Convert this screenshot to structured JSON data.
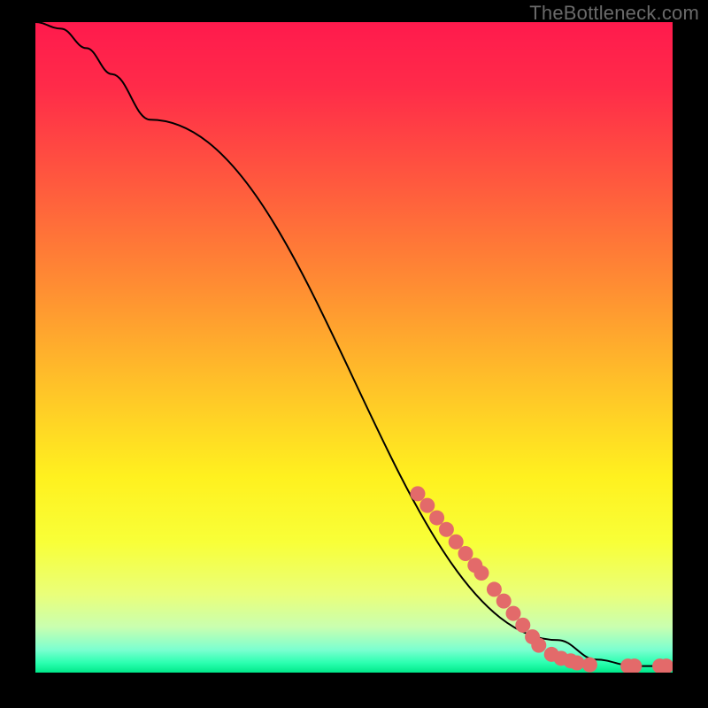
{
  "watermark": "TheBottleneck.com",
  "chart_data": {
    "type": "line",
    "title": "",
    "xlabel": "",
    "ylabel": "",
    "xlim": [
      0,
      100
    ],
    "ylim": [
      0,
      100
    ],
    "grid": false,
    "series": [
      {
        "name": "curve",
        "x": [
          0,
          4,
          8,
          12,
          18,
          82,
          88,
          94,
          100
        ],
        "y": [
          100,
          99,
          96,
          92,
          85,
          5,
          2,
          1,
          1
        ]
      }
    ],
    "markers": {
      "name": "highlight-points",
      "x": [
        60,
        61.5,
        63,
        64.5,
        66,
        67.5,
        69,
        70,
        72,
        73.5,
        75,
        76.5,
        78,
        79,
        81,
        82.5,
        84,
        85,
        87,
        93,
        94,
        98,
        99
      ],
      "y": [
        27.5,
        25.7,
        23.8,
        22.0,
        20.1,
        18.3,
        16.5,
        15.3,
        12.8,
        11.0,
        9.1,
        7.3,
        5.5,
        4.2,
        2.8,
        2.2,
        1.8,
        1.5,
        1.2,
        1.0,
        1.0,
        1.0,
        1.0
      ]
    },
    "gradient_stops": [
      {
        "offset": 0.0,
        "color": "#ff1a4d"
      },
      {
        "offset": 0.1,
        "color": "#ff2b49"
      },
      {
        "offset": 0.25,
        "color": "#ff5a3e"
      },
      {
        "offset": 0.4,
        "color": "#ff8b33"
      },
      {
        "offset": 0.55,
        "color": "#ffbf29"
      },
      {
        "offset": 0.7,
        "color": "#fff11f"
      },
      {
        "offset": 0.8,
        "color": "#f8ff38"
      },
      {
        "offset": 0.88,
        "color": "#eaff7a"
      },
      {
        "offset": 0.93,
        "color": "#c9ffb0"
      },
      {
        "offset": 0.965,
        "color": "#7bffd0"
      },
      {
        "offset": 0.985,
        "color": "#2bffb0"
      },
      {
        "offset": 1.0,
        "color": "#00e88a"
      }
    ],
    "marker_color": "#e36a6a",
    "curve_color": "#000000"
  }
}
